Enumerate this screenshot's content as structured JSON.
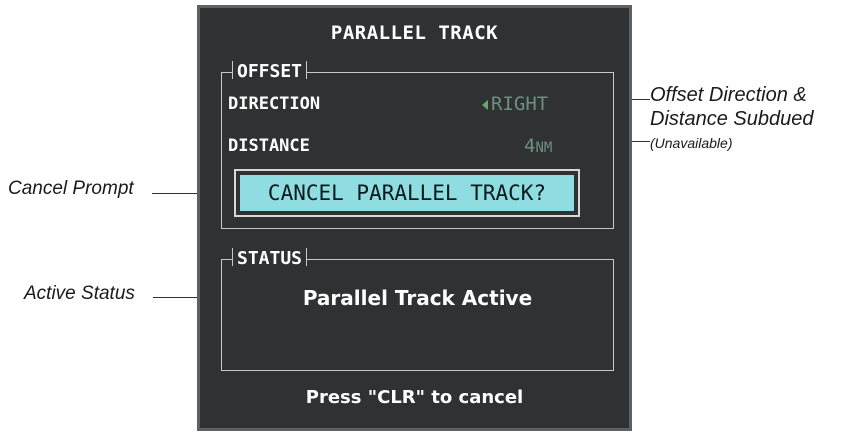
{
  "window": {
    "title": "PARALLEL TRACK",
    "offset_group": {
      "label": "OFFSET",
      "direction_label": "DIRECTION",
      "direction_value": "RIGHT",
      "distance_label": "DISTANCE",
      "distance_value": "4",
      "distance_unit": "NM"
    },
    "prompt": "CANCEL PARALLEL TRACK?",
    "status_group": {
      "label": "STATUS",
      "text": "Parallel Track Active"
    },
    "footer": "Press \"CLR\" to cancel"
  },
  "callouts": {
    "offset_line1": "Offset Direction &",
    "offset_line2": "Distance Subdued",
    "offset_note": "(Unavailable)",
    "cancel_prompt": "Cancel Prompt",
    "active_status": "Active Status"
  },
  "colors": {
    "window_bg": "#2f3132",
    "prompt_bg": "#8fdde0",
    "subdued_text": "#6f8f82"
  }
}
